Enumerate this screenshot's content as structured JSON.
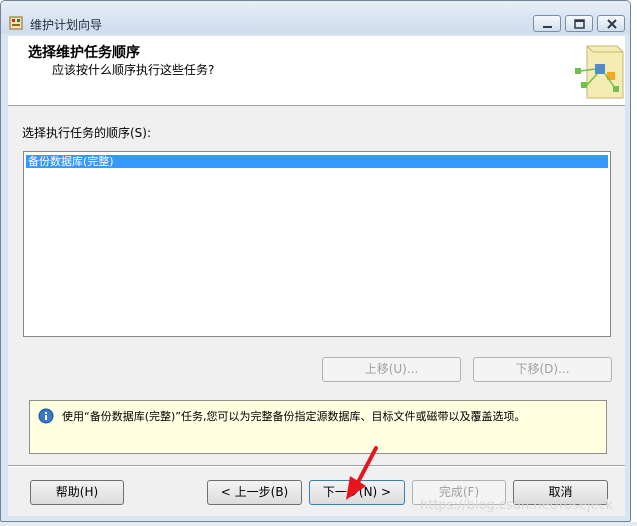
{
  "window": {
    "title": "维护计划向导"
  },
  "header": {
    "title": "选择维护任务顺序",
    "subtitle": "应该按什么顺序执行这些任务?"
  },
  "order": {
    "label": "选择执行任务的顺序(S):",
    "items": [
      "备份数据库(完整)"
    ],
    "selected_index": 0,
    "move_up_label": "上移(U)...",
    "move_down_label": "下移(D)..."
  },
  "info": {
    "text": "使用“备份数据库(完整)”任务,您可以为完整备份指定源数据库、目标文件或磁带以及覆盖选项。"
  },
  "footer": {
    "help_label": "帮助(H)",
    "back_label": "< 上一步(B)",
    "next_label": "下一步(N) >",
    "finish_label": "完成(F)",
    "cancel_label": "取消"
  },
  "watermark": "https://blog.csdn.net/rosejeck",
  "colors": {
    "selection": "#3399ff",
    "info_background": "#ffffe1",
    "annotation_arrow": "#e8141c"
  },
  "icons": [
    "app-icon",
    "minimize-icon",
    "maximize-icon",
    "close-icon",
    "wizard-header-icon",
    "info-icon",
    "red-arrow-annotation"
  ]
}
